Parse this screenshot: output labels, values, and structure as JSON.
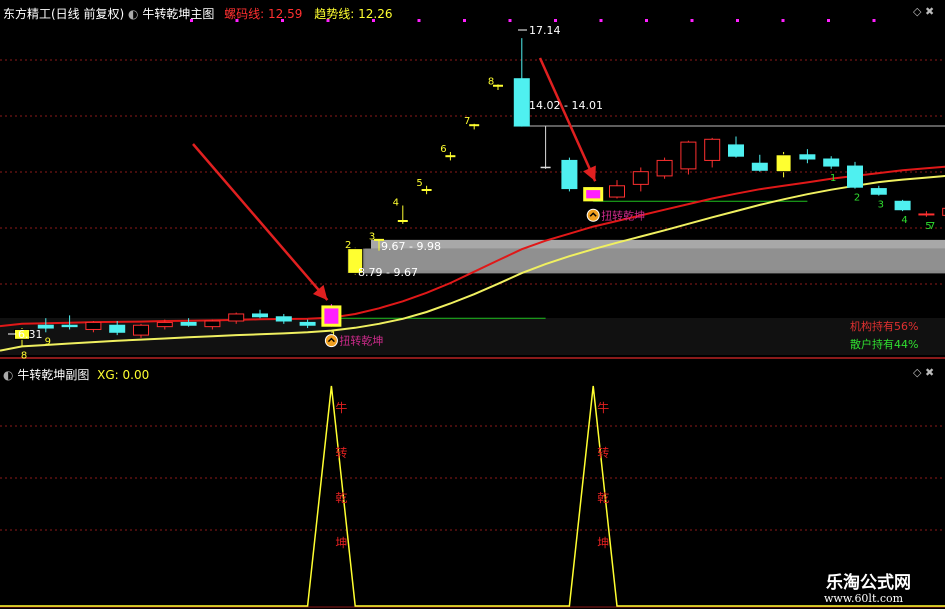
{
  "main_header": {
    "stock_title": "东方精工(日线 前复权)",
    "indicator_name": "牛转乾坤主图",
    "line1_label": "螺码线:",
    "line1_value": "12.59",
    "line2_label": "趋势线:",
    "line2_value": "12.26"
  },
  "sub_header": {
    "indicator_name": "牛转乾坤副图",
    "xg_label": "XG:",
    "xg_value": "0.00"
  },
  "colors": {
    "background": "#000000",
    "up_candle": "#ff3030",
    "down_candle": "#4ff0f0",
    "signal_yellow": "#ffff30",
    "signal_magenta": "#ff20ff",
    "red_line": "#e01818",
    "yellow_line": "#f0f060",
    "grid": "#8b1a1a"
  },
  "annotations": {
    "price_min_label": "6.31",
    "price_max_label": "17.14",
    "zone1_label": "9.67 - 9.98",
    "zone2_label": "8.79 - 9.67",
    "zone3_label": "14.02 - 14.01",
    "signal_text": "扭转乾坤",
    "inst_label": "机构持有56%",
    "retail_label": "散户持有44%"
  },
  "chart_data": [
    {
      "type": "candlestick",
      "title": "牛转乾坤主图",
      "candles": [
        {
          "o": 6.45,
          "h": 6.85,
          "l": 6.2,
          "c": 6.8,
          "style": "yellow",
          "num": "8"
        },
        {
          "o": 6.85,
          "h": 7.2,
          "l": 6.7,
          "c": 6.95,
          "style": "down",
          "num": "9"
        },
        {
          "o": 6.95,
          "h": 7.3,
          "l": 6.8,
          "c": 6.9,
          "style": "down",
          "num": ""
        },
        {
          "o": 6.8,
          "h": 7.1,
          "l": 6.7,
          "c": 7.05,
          "style": "up",
          "num": ""
        },
        {
          "o": 6.95,
          "h": 7.1,
          "l": 6.6,
          "c": 6.7,
          "style": "down",
          "num": ""
        },
        {
          "o": 6.6,
          "h": 7.0,
          "l": 6.5,
          "c": 6.95,
          "style": "up",
          "num": ""
        },
        {
          "o": 6.9,
          "h": 7.15,
          "l": 6.8,
          "c": 7.05,
          "style": "up",
          "num": ""
        },
        {
          "o": 7.05,
          "h": 7.2,
          "l": 6.9,
          "c": 6.95,
          "style": "down",
          "num": ""
        },
        {
          "o": 6.9,
          "h": 7.15,
          "l": 6.8,
          "c": 7.1,
          "style": "up",
          "num": ""
        },
        {
          "o": 7.1,
          "h": 7.4,
          "l": 7.0,
          "c": 7.35,
          "style": "up",
          "num": ""
        },
        {
          "o": 7.35,
          "h": 7.5,
          "l": 7.2,
          "c": 7.25,
          "style": "down",
          "num": ""
        },
        {
          "o": 7.25,
          "h": 7.35,
          "l": 7.0,
          "c": 7.1,
          "style": "down",
          "num": ""
        },
        {
          "o": 7.05,
          "h": 7.15,
          "l": 6.85,
          "c": 6.95,
          "style": "down",
          "num": ""
        },
        {
          "o": 6.95,
          "h": 7.7,
          "l": 6.9,
          "c": 7.6,
          "style": "magenta",
          "num": "1"
        },
        {
          "o": 8.79,
          "h": 9.7,
          "l": 8.75,
          "c": 9.67,
          "style": "yellow",
          "num": "2"
        },
        {
          "o": 9.67,
          "h": 10.0,
          "l": 9.6,
          "c": 9.98,
          "style": "yellow_dash",
          "num": "3"
        },
        {
          "o": 10.6,
          "h": 11.2,
          "l": 10.55,
          "c": 10.65,
          "style": "yellow_dash",
          "num": "4"
        },
        {
          "o": 11.7,
          "h": 11.9,
          "l": 11.6,
          "c": 11.75,
          "style": "yellow_dash",
          "num": "5"
        },
        {
          "o": 12.9,
          "h": 13.1,
          "l": 12.8,
          "c": 12.95,
          "style": "yellow_dash",
          "num": "6"
        },
        {
          "o": 14.0,
          "h": 14.1,
          "l": 13.9,
          "c": 14.05,
          "style": "yellow_dash",
          "num": "7"
        },
        {
          "o": 15.4,
          "h": 15.5,
          "l": 15.3,
          "c": 15.45,
          "style": "yellow_dash",
          "num": "8"
        },
        {
          "o": 15.7,
          "h": 17.14,
          "l": 14.0,
          "c": 14.02,
          "style": "down",
          "num": ""
        },
        {
          "o": 14.01,
          "h": 14.01,
          "l": 12.5,
          "c": 12.55,
          "style": "down_dash",
          "num": ""
        },
        {
          "o": 12.8,
          "h": 12.9,
          "l": 11.7,
          "c": 11.8,
          "style": "down",
          "num": ""
        },
        {
          "o": 11.8,
          "h": 11.85,
          "l": 11.35,
          "c": 11.4,
          "style": "magenta",
          "num": ""
        },
        {
          "o": 11.5,
          "h": 12.1,
          "l": 11.45,
          "c": 11.9,
          "style": "up",
          "num": ""
        },
        {
          "o": 11.95,
          "h": 12.55,
          "l": 11.7,
          "c": 12.4,
          "style": "up",
          "num": ""
        },
        {
          "o": 12.25,
          "h": 12.9,
          "l": 12.15,
          "c": 12.8,
          "style": "up",
          "num": ""
        },
        {
          "o": 12.5,
          "h": 13.5,
          "l": 12.3,
          "c": 13.45,
          "style": "up",
          "num": ""
        },
        {
          "o": 12.8,
          "h": 13.6,
          "l": 12.55,
          "c": 13.55,
          "style": "up",
          "num": ""
        },
        {
          "o": 13.35,
          "h": 13.65,
          "l": 12.9,
          "c": 12.95,
          "style": "down",
          "num": ""
        },
        {
          "o": 12.7,
          "h": 13.0,
          "l": 12.4,
          "c": 12.45,
          "style": "down",
          "num": ""
        },
        {
          "o": 12.4,
          "h": 13.1,
          "l": 12.2,
          "c": 13.0,
          "style": "yellow",
          "num": ""
        },
        {
          "o": 13.0,
          "h": 13.2,
          "l": 12.7,
          "c": 12.85,
          "style": "down",
          "num": ""
        },
        {
          "o": 12.85,
          "h": 12.95,
          "l": 12.5,
          "c": 12.6,
          "style": "down",
          "num": "1"
        },
        {
          "o": 12.6,
          "h": 12.75,
          "l": 11.8,
          "c": 11.85,
          "style": "down",
          "num": "2"
        },
        {
          "o": 11.8,
          "h": 11.9,
          "l": 11.55,
          "c": 11.6,
          "style": "down",
          "num": "3"
        },
        {
          "o": 11.35,
          "h": 11.4,
          "l": 11.0,
          "c": 11.05,
          "style": "down",
          "num": "4"
        },
        {
          "o": 10.9,
          "h": 11.0,
          "l": 10.8,
          "c": 10.9,
          "style": "up",
          "num": "5"
        },
        {
          "o": 10.85,
          "h": 11.2,
          "l": 10.75,
          "c": 11.1,
          "style": "up",
          "num": "6"
        }
      ],
      "red_line": [
        7.0,
        7.02,
        7.04,
        7.06,
        7.07,
        7.08,
        7.1,
        7.11,
        7.12,
        7.14,
        7.16,
        7.17,
        7.18,
        7.22,
        7.35,
        7.55,
        7.8,
        8.1,
        8.45,
        8.85,
        9.25,
        9.65,
        9.95,
        10.2,
        10.45,
        10.65,
        10.85,
        11.05,
        11.25,
        11.45,
        11.62,
        11.78,
        11.9,
        12.02,
        12.15,
        12.25,
        12.35,
        12.45,
        12.52,
        12.59
      ],
      "yellow_line": [
        6.2,
        6.25,
        6.3,
        6.35,
        6.4,
        6.44,
        6.48,
        6.52,
        6.56,
        6.6,
        6.63,
        6.66,
        6.7,
        6.76,
        6.86,
        7.0,
        7.18,
        7.42,
        7.72,
        8.05,
        8.42,
        8.8,
        9.12,
        9.4,
        9.65,
        9.88,
        10.1,
        10.32,
        10.55,
        10.78,
        11.0,
        11.22,
        11.42,
        11.6,
        11.76,
        11.9,
        12.03,
        12.12,
        12.19,
        12.26
      ],
      "ylim": [
        6.0,
        17.5
      ],
      "zones": [
        {
          "low": 9.67,
          "high": 9.98,
          "from": 15,
          "to": 40
        },
        {
          "low": 8.79,
          "high": 9.67,
          "from": 14,
          "to": 40
        },
        {
          "low": 14.02,
          "high": 14.02,
          "from": 21,
          "to": 40
        }
      ],
      "green_lines": [
        {
          "y": 7.2,
          "from": 13,
          "to": 22
        },
        {
          "y": 11.35,
          "from": 24,
          "to": 33
        }
      ],
      "signals": [
        13,
        24
      ],
      "right_bottom_nums": [
        "7"
      ]
    },
    {
      "type": "line",
      "title": "牛转乾坤副图",
      "x": [
        0,
        12,
        13,
        14,
        23,
        24,
        25,
        40
      ],
      "values": [
        0,
        0,
        1,
        0,
        0,
        1,
        0,
        0
      ],
      "ylim": [
        0,
        1
      ],
      "peak_text": [
        "牛",
        "转",
        "乾",
        "坤"
      ]
    }
  ],
  "watermark": {
    "cn": "乐淘公式网",
    "url": "www.60lt.com"
  }
}
